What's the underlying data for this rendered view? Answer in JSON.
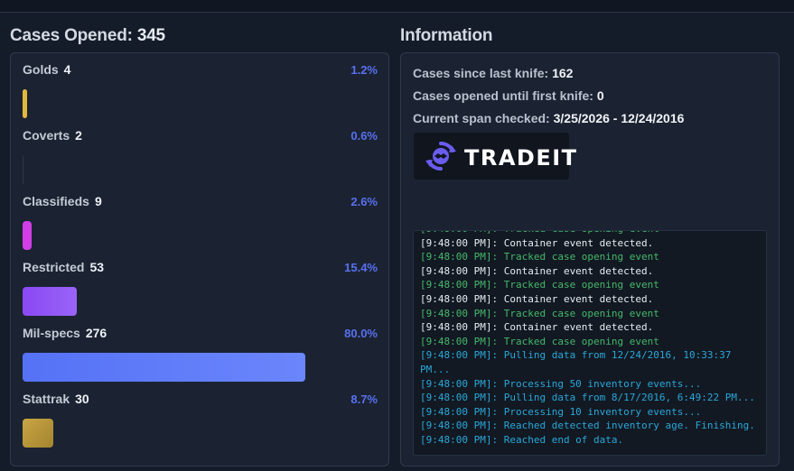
{
  "left": {
    "title": "Cases Opened:",
    "total": "345",
    "rarities": [
      {
        "name": "Golds",
        "count": "4",
        "percent": "1.2%",
        "fraction": 0.012,
        "color": "#e2b93d"
      },
      {
        "name": "Coverts",
        "count": "2",
        "percent": "0.6%",
        "fraction": 0.006,
        "color": "#2d3646"
      },
      {
        "name": "Classifieds",
        "count": "9",
        "percent": "2.6%",
        "fraction": 0.026,
        "color": "#d23fe6"
      },
      {
        "name": "Restricted",
        "count": "53",
        "percent": "15.4%",
        "fraction": 0.154,
        "color": "#8a4ff5"
      },
      {
        "name": "Mil-specs",
        "count": "276",
        "percent": "80.0%",
        "fraction": 0.8,
        "color": "#5c78f7"
      },
      {
        "name": "Stattrak",
        "count": "30",
        "percent": "8.7%",
        "fraction": 0.087,
        "color": "#b89a3c"
      }
    ]
  },
  "right": {
    "title": "Information",
    "since_label": "Cases since last knife:",
    "since_value": "162",
    "until_label": "Cases opened until first knife:",
    "until_value": "0",
    "span_label": "Current span checked:",
    "span_value": "3/25/2026 - 12/24/2016",
    "logo_text": "TRADEIT",
    "log": [
      {
        "text": "[9:48:00 PM]: Tracked case opening event",
        "kind": "green"
      },
      {
        "text": "[9:48:00 PM]: Container event detected.",
        "kind": "white"
      },
      {
        "text": "[9:48:00 PM]: Tracked case opening event",
        "kind": "green"
      },
      {
        "text": "[9:48:00 PM]: Container event detected.",
        "kind": "white"
      },
      {
        "text": "[9:48:00 PM]: Tracked case opening event",
        "kind": "green"
      },
      {
        "text": "[9:48:00 PM]: Container event detected.",
        "kind": "white"
      },
      {
        "text": "[9:48:00 PM]: Tracked case opening event",
        "kind": "green"
      },
      {
        "text": "[9:48:00 PM]: Container event detected.",
        "kind": "white"
      },
      {
        "text": "[9:48:00 PM]: Tracked case opening event",
        "kind": "green"
      },
      {
        "text": "[9:48:00 PM]: Pulling data from 12/24/2016, 10:33:37 PM...",
        "kind": "cyan"
      },
      {
        "text": "[9:48:00 PM]: Processing 50 inventory events...",
        "kind": "cyan"
      },
      {
        "text": "[9:48:00 PM]: Pulling data from 8/17/2016, 6:49:22 PM...",
        "kind": "cyan"
      },
      {
        "text": "[9:48:00 PM]: Processing 10 inventory events...",
        "kind": "cyan"
      },
      {
        "text": "[9:48:00 PM]: Reached detected inventory age. Finishing.",
        "kind": "cyan"
      },
      {
        "text": "[9:48:00 PM]: Reached end of data.",
        "kind": "cyan"
      }
    ]
  }
}
